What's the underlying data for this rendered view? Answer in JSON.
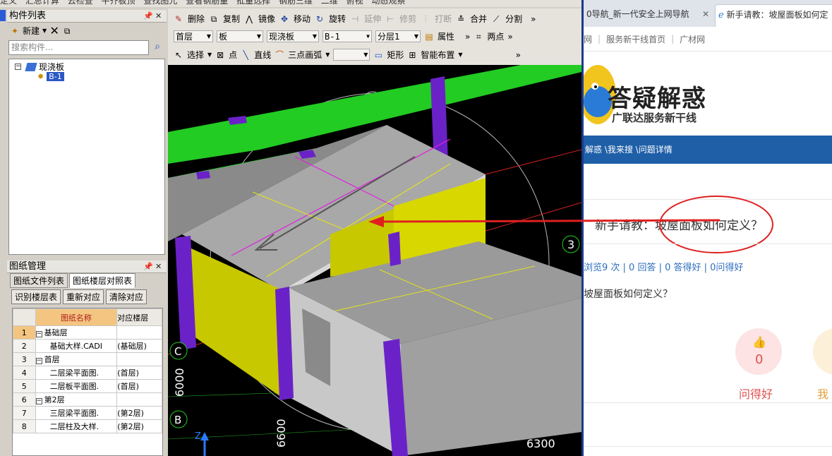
{
  "cad": {
    "top_menu": [
      "定义",
      "汇总计算",
      "云检查",
      "平齐板顶",
      "查找图元",
      "查看钢筋量",
      "批量选择",
      "钢筋三维",
      "二维",
      "俯视",
      "动态观察"
    ],
    "component_panel": {
      "title": "构件列表",
      "new_label": "新建",
      "search_placeholder": "搜索构件...",
      "tree_root": "现浇板",
      "tree_child": "B-1"
    },
    "toolbar_row1": [
      "删除",
      "复制",
      "镜像",
      "移动",
      "旋转",
      "延伸",
      "修剪",
      "打断",
      "合并",
      "分割"
    ],
    "toolbar_row2": {
      "floor": "首层",
      "type": "板",
      "subtype": "现浇板",
      "component": "B-1",
      "layer": "分层1",
      "property": "属性",
      "two_point": "两点"
    },
    "toolbar_row3": {
      "select": "选择",
      "point": "点",
      "line": "直线",
      "arc": "三点画弧",
      "rect": "矩形",
      "smart": "智能布置"
    },
    "drawing_panel": {
      "title": "图纸管理",
      "tabs": [
        "图纸文件列表",
        "图纸楼层对照表"
      ],
      "buttons": [
        "识别楼层表",
        "重新对应",
        "清除对应"
      ],
      "columns": [
        "图纸名称",
        "对应楼层"
      ],
      "rows": [
        {
          "n": "1",
          "name": "基础层",
          "floor": "",
          "group": true
        },
        {
          "n": "2",
          "name": "基础大样.CADI",
          "floor": "(基础层)",
          "group": false
        },
        {
          "n": "3",
          "name": "首层",
          "floor": "",
          "group": true
        },
        {
          "n": "4",
          "name": "二层梁平面图.",
          "floor": "(首层)",
          "group": false
        },
        {
          "n": "5",
          "name": "二层板平面图.",
          "floor": "(首层)",
          "group": false
        },
        {
          "n": "6",
          "name": "第2层",
          "floor": "",
          "group": true
        },
        {
          "n": "7",
          "name": "三层梁平面图.",
          "floor": "(第2层)",
          "group": false
        },
        {
          "n": "8",
          "name": "二层柱及大样.",
          "floor": "(第2层)",
          "group": false
        }
      ]
    },
    "viewport": {
      "axis_labels": [
        "3",
        "C",
        "B"
      ],
      "dims": [
        "6000",
        "6600",
        "6300"
      ],
      "z_label": "Z"
    }
  },
  "browser": {
    "tabs": [
      {
        "title": "0导航_新一代安全上网导航"
      },
      {
        "title": "新手请教：坡屋面板如何定"
      }
    ],
    "site_nav": [
      "网",
      "服务新干线首页",
      "广材网"
    ],
    "logo_main": "答疑解惑",
    "logo_sub": "广联达服务新干线",
    "breadcrumb": "解惑 \\我来搜 \\问题详情",
    "question_title": "新手请教：坡屋面板如何定义？",
    "stats": "浏览9 次 | 0 回答 | 0 答得好 | 0问得好",
    "question_body": "坡屋面板如何定义？",
    "like_count": "0",
    "like_label": "问得好",
    "like_label2": "我",
    "colors": {
      "nav_blue": "#1e5fa8",
      "red_annot": "#e02020",
      "pink": "#fde3e3"
    }
  }
}
